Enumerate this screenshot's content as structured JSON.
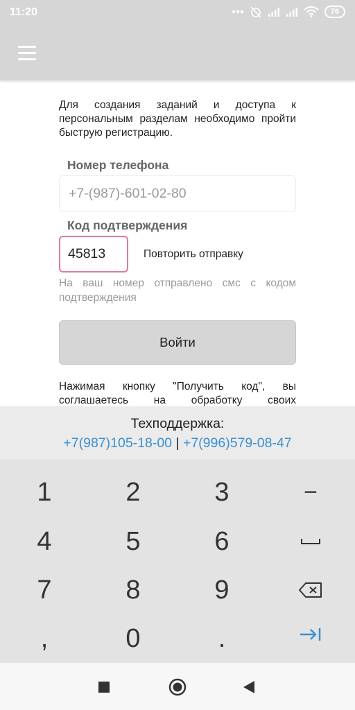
{
  "status_bar": {
    "time": "11:20",
    "battery": "76",
    "icons": [
      "more-dots-icon",
      "alarm-off-icon",
      "signal-icon",
      "signal-icon",
      "wifi-icon",
      "battery-icon"
    ]
  },
  "app_bar": {
    "menu_icon": "hamburger-menu-icon",
    "color": "#d6d6d6"
  },
  "form": {
    "intro": "Для создания заданий и доступа к персональным разделам необходимо пройти быструю регистрацию.",
    "phone_label": "Номер телефона",
    "phone_value": "+7-(987)-601-02-80",
    "code_label": "Код подтверждения",
    "code_value": "45813",
    "resend_label": "Повторить отправку",
    "hint": "На ваш номер отправлено смс с кодом подтверждения",
    "login_label": "Войти",
    "consent": "Нажимая кнопку \"Получить код\", вы соглашаетесь на обработку своих персональных данных."
  },
  "support": {
    "title": "Техподдержка:",
    "phone1": "+7(987)105-18-00",
    "separator": " | ",
    "phone2": "+7(996)579-08-47",
    "link_color": "#3a8fd1"
  },
  "keyboard": {
    "rows": [
      [
        "1",
        "2",
        "3",
        "−"
      ],
      [
        "4",
        "5",
        "6",
        "space-icon"
      ],
      [
        "7",
        "8",
        "9",
        "backspace-icon"
      ],
      [
        ",",
        "0",
        ".",
        "next-field-icon"
      ]
    ],
    "accent": "#3a8fd1"
  },
  "navbar": {
    "buttons": [
      "recents-square-icon",
      "home-circle-icon",
      "back-triangle-icon"
    ]
  }
}
